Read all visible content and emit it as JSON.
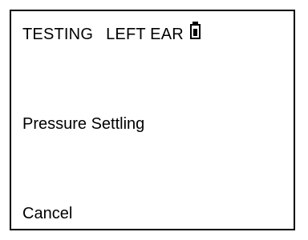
{
  "header": {
    "mode": "TESTING",
    "ear": "LEFT EAR",
    "battery_icon": "battery-icon",
    "battery_level": 0.6
  },
  "status": {
    "text": "Pressure Settling"
  },
  "softkey": {
    "cancel_label": "Cancel"
  },
  "colors": {
    "background": "#ffffff",
    "foreground": "#000000"
  }
}
